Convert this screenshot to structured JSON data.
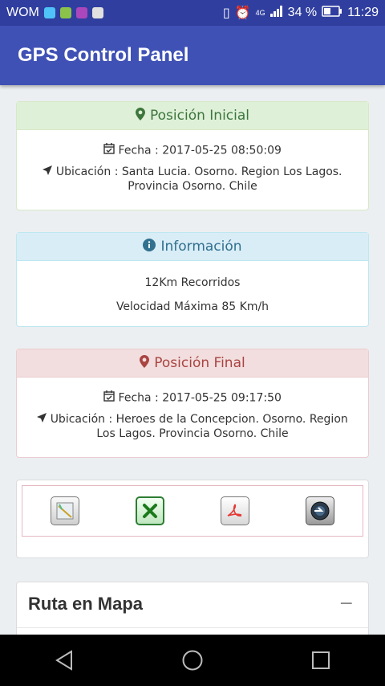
{
  "status_bar": {
    "carrier": "WOM",
    "network": "4G",
    "battery": "34 %",
    "time": "11:29"
  },
  "app_bar": {
    "title": "GPS Control Panel"
  },
  "start_card": {
    "title": "Posición Inicial",
    "date": "Fecha : 2017-05-25 08:50:09",
    "location": "Ubicación : Santa Lucia. Osorno. Region Los Lagos. Provincia Osorno. Chile"
  },
  "info_card": {
    "title": "Información",
    "distance": "12Km Recorridos",
    "max_speed": "Velocidad Máxima 85 Km/h"
  },
  "end_card": {
    "title": "Posición Final",
    "date": "Fecha : 2017-05-25 09:17:50",
    "location": "Ubicación : Heroes de la Concepcion. Osorno. Region Los Lagos. Provincia Osorno. Chile"
  },
  "toolbar": {
    "icons": [
      "map-export-icon",
      "excel-icon",
      "pdf-icon",
      "camera-icon"
    ]
  },
  "map_card": {
    "title": "Ruta en Mapa",
    "collapse": "−"
  },
  "colors": {
    "primary": "#3f51b5",
    "primary_dark": "#303f9f",
    "success_bg": "#dff0d8",
    "info_bg": "#d9edf7",
    "danger_bg": "#f2dede"
  }
}
